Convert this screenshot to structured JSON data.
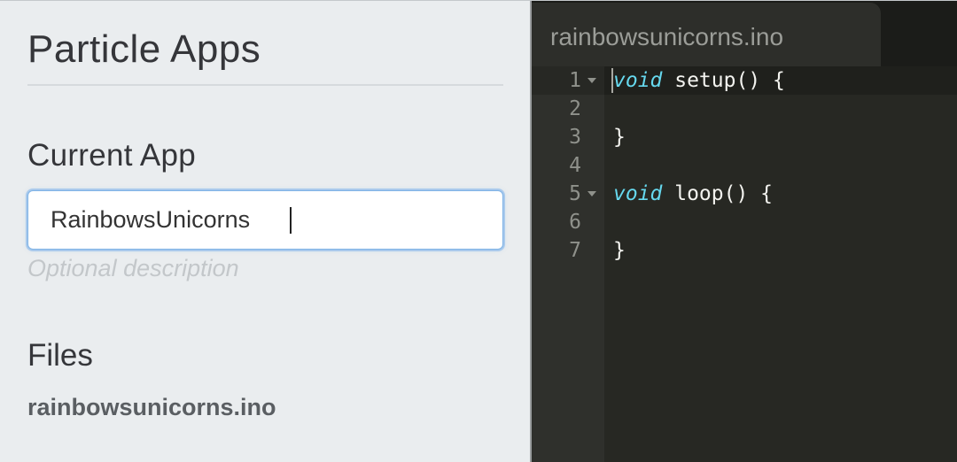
{
  "sidebar": {
    "title": "Particle Apps",
    "current_app_label": "Current App",
    "app_name_value": "RainbowsUnicorns",
    "description_placeholder": "Optional description",
    "files_label": "Files",
    "files": [
      "rainbowsunicorns.ino"
    ]
  },
  "editor": {
    "tab_label": "rainbowsunicorns.ino",
    "lines": [
      {
        "num": "1",
        "keyword": "void",
        "rest": " setup() {",
        "foldable": true
      },
      {
        "num": "2",
        "keyword": "",
        "rest": "",
        "foldable": false
      },
      {
        "num": "3",
        "keyword": "",
        "rest": "}",
        "foldable": false
      },
      {
        "num": "4",
        "keyword": "",
        "rest": "",
        "foldable": false
      },
      {
        "num": "5",
        "keyword": "void",
        "rest": " loop() {",
        "foldable": true
      },
      {
        "num": "6",
        "keyword": "",
        "rest": "",
        "foldable": false
      },
      {
        "num": "7",
        "keyword": "",
        "rest": "}",
        "foldable": false
      }
    ],
    "colors": {
      "background": "#272823",
      "keyword": "#66d9ef",
      "text": "#f3f3ef",
      "gutter": "#2f302c"
    }
  }
}
